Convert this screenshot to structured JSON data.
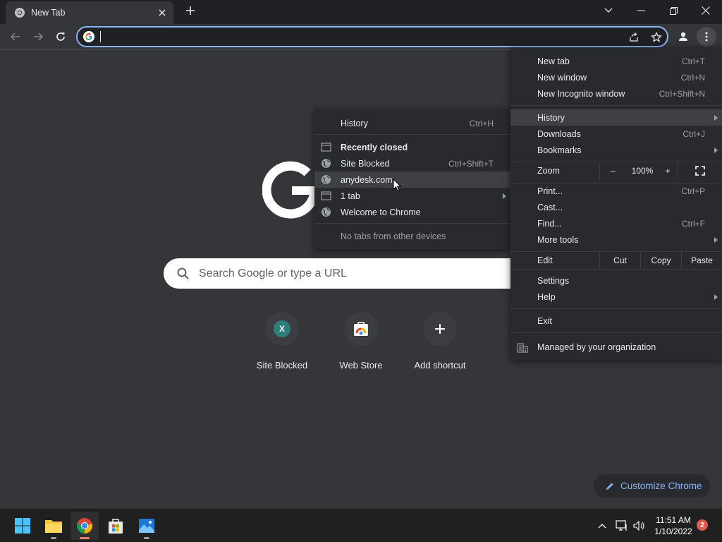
{
  "tab": {
    "title": "New Tab",
    "close_icon": "close-icon"
  },
  "omnibox": {
    "value": "",
    "placeholder": ""
  },
  "ntp": {
    "search_placeholder": "Search Google or type a URL",
    "shortcuts": [
      {
        "label": "Site Blocked",
        "letter": "X"
      },
      {
        "label": "Web Store"
      },
      {
        "label": "Add shortcut"
      }
    ],
    "customize_label": "Customize Chrome"
  },
  "menu": {
    "new_tab": {
      "label": "New tab",
      "shortcut": "Ctrl+T"
    },
    "new_window": {
      "label": "New window",
      "shortcut": "Ctrl+N"
    },
    "new_incognito": {
      "label": "New Incognito window",
      "shortcut": "Ctrl+Shift+N"
    },
    "history": {
      "label": "History"
    },
    "downloads": {
      "label": "Downloads",
      "shortcut": "Ctrl+J"
    },
    "bookmarks": {
      "label": "Bookmarks"
    },
    "zoom": {
      "label": "Zoom",
      "minus": "–",
      "value": "100%",
      "plus": "+"
    },
    "print": {
      "label": "Print...",
      "shortcut": "Ctrl+P"
    },
    "cast": {
      "label": "Cast..."
    },
    "find": {
      "label": "Find...",
      "shortcut": "Ctrl+F"
    },
    "more_tools": {
      "label": "More tools"
    },
    "edit": {
      "label": "Edit",
      "cut": "Cut",
      "copy": "Copy",
      "paste": "Paste"
    },
    "settings": {
      "label": "Settings"
    },
    "help": {
      "label": "Help"
    },
    "exit": {
      "label": "Exit"
    },
    "managed": {
      "label": "Managed by your organization"
    }
  },
  "history_submenu": {
    "history": {
      "label": "History",
      "shortcut": "Ctrl+H"
    },
    "recently_closed": {
      "label": "Recently closed"
    },
    "items": [
      {
        "label": "Site Blocked",
        "shortcut": "Ctrl+Shift+T"
      },
      {
        "label": "anydesk.com"
      },
      {
        "label": "1 tab"
      },
      {
        "label": "Welcome to Chrome"
      }
    ],
    "no_tabs": {
      "label": "No tabs from other devices"
    }
  },
  "taskbar": {
    "time": "11:51 AM",
    "date": "1/10/2022",
    "notifications": "2"
  },
  "colors": {
    "background": "#35363a",
    "menu": "#292a2d",
    "accent": "#8ab4f8",
    "titlebar": "#202124"
  }
}
